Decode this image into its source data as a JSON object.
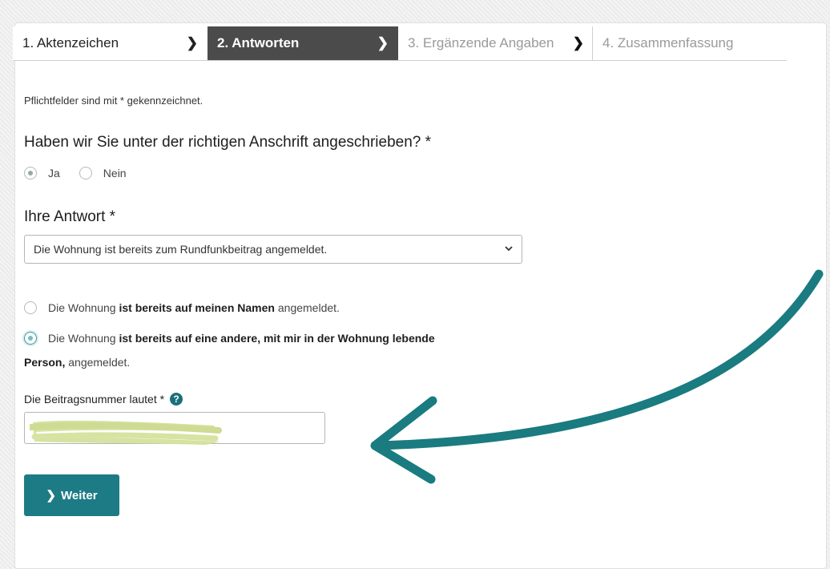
{
  "stepper": {
    "steps": [
      {
        "label": "1. Aktenzeichen"
      },
      {
        "label": "2. Antworten"
      },
      {
        "label": "3. Ergänzende Angaben"
      },
      {
        "label": "4. Zusammenfassung"
      }
    ],
    "chevron": "❯"
  },
  "form": {
    "required_note": "Pflichtfelder sind mit * gekennzeichnet.",
    "question_address": "Haben wir Sie unter der richtigen Anschrift angeschrieben? *",
    "address_options": [
      {
        "label": "Ja",
        "selected": true
      },
      {
        "label": "Nein",
        "selected": false
      }
    ],
    "answer_heading": "Ihre Antwort *",
    "answer_select_value": "Die Wohnung ist bereits zum Rundfunkbeitrag angemeldet.",
    "registration_options": [
      {
        "pre": "Die Wohnung ",
        "bold": "ist bereits auf meinen Namen",
        "post": " angemeldet.",
        "selected": false
      },
      {
        "pre": "Die Wohnung ",
        "bold": "ist bereits auf eine andere, mit mir in der Wohnung lebende",
        "selected": true
      }
    ],
    "registration_option2_cont_bold": "Person,",
    "registration_option2_cont_post": " angemeldet.",
    "beitrag_label": "Die Beitragsnummer lautet *",
    "help_glyph": "?",
    "beitrag_value": "",
    "submit_label": "Weiter",
    "submit_chevron": "❯"
  },
  "colors": {
    "accent_teal": "#1c7b85",
    "active_step": "#4b4b4b",
    "annotation_arrow": "#1a7b80",
    "redaction": "#d4e09b"
  },
  "icons": {
    "select_caret": "chevron-down-icon",
    "help": "help-circle-icon",
    "step_separator": "chevron-right-icon"
  }
}
